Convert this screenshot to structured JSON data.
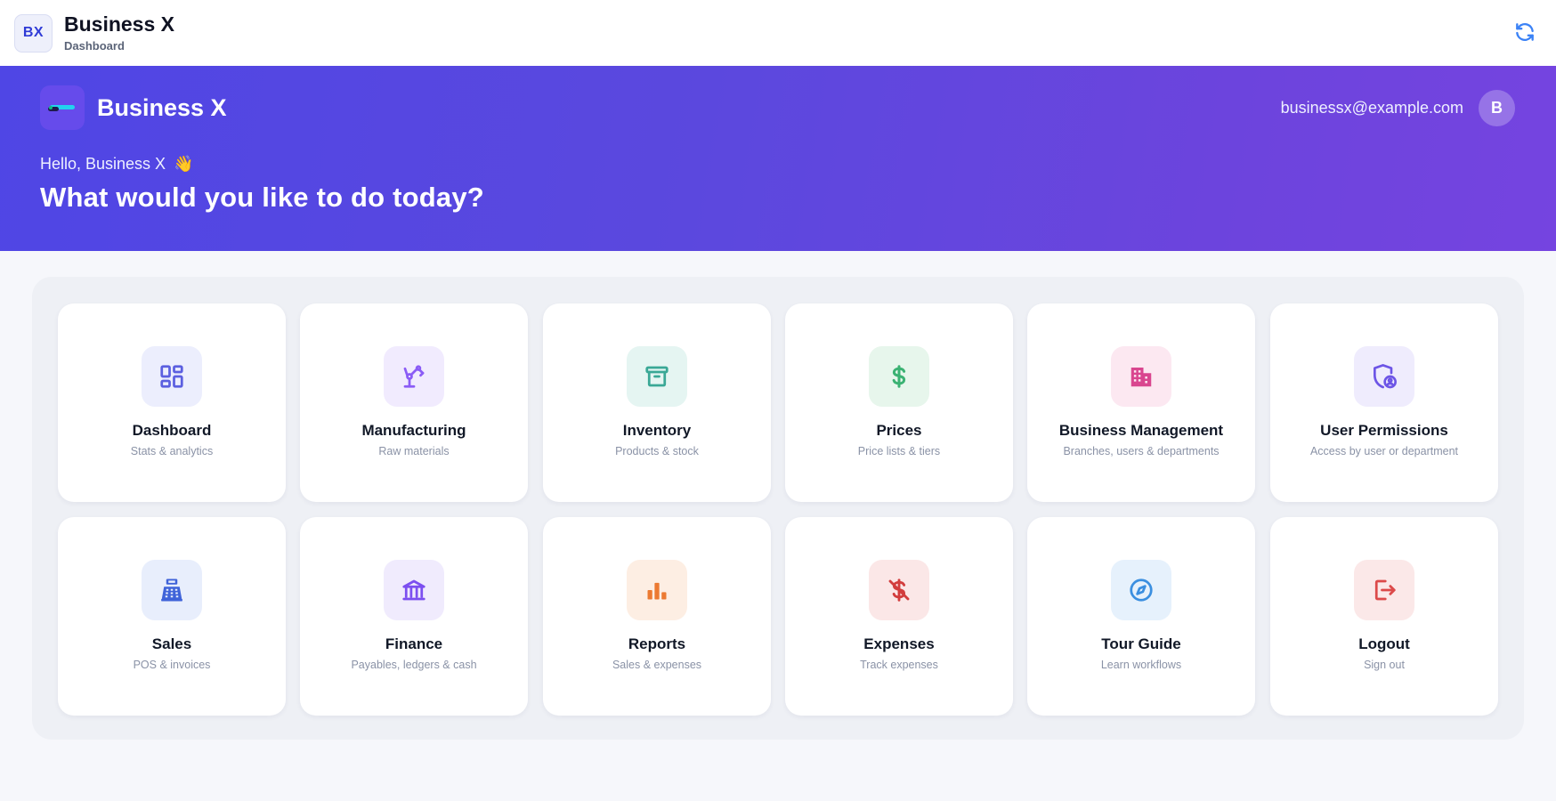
{
  "app": {
    "badge": "BX",
    "title": "Business X",
    "subtitle": "Dashboard",
    "sync_icon": "refresh-icon"
  },
  "hero": {
    "brand_name": "Business X",
    "email": "businessx@example.com",
    "avatar_initial": "B",
    "greeting": "Hello, Business X",
    "wave_emoji": "👋",
    "headline": "What would you like to do today?"
  },
  "tiles": [
    {
      "title": "Dashboard",
      "description": "Stats & analytics",
      "icon": "dashboard-icon",
      "color": "#5b5fe0",
      "bg": "#eceefd"
    },
    {
      "title": "Manufacturing",
      "description": "Raw materials",
      "icon": "robot-arm-icon",
      "color": "#8b5cf6",
      "bg": "#f1ebfe"
    },
    {
      "title": "Inventory",
      "description": "Products & stock",
      "icon": "archive-box-icon",
      "color": "#3aa896",
      "bg": "#e5f5f2"
    },
    {
      "title": "Prices",
      "description": "Price lists & tiers",
      "icon": "dollar-icon",
      "color": "#3bb273",
      "bg": "#e7f6ec"
    },
    {
      "title": "Business Management",
      "description": "Branches, users & departments",
      "icon": "building-icon",
      "color": "#d9468f",
      "bg": "#fce8f1"
    },
    {
      "title": "User Permissions",
      "description": "Access by user or department",
      "icon": "shield-user-icon",
      "color": "#6d55e6",
      "bg": "#efecfd"
    },
    {
      "title": "Sales",
      "description": "POS & invoices",
      "icon": "cash-register-icon",
      "color": "#3f63d9",
      "bg": "#e8eefc"
    },
    {
      "title": "Finance",
      "description": "Payables, ledgers & cash",
      "icon": "bank-icon",
      "color": "#7c4ff0",
      "bg": "#f0ebfd"
    },
    {
      "title": "Reports",
      "description": "Sales & expenses",
      "icon": "bar-chart-icon",
      "color": "#ec7a32",
      "bg": "#fdeee3"
    },
    {
      "title": "Expenses",
      "description": "Track expenses",
      "icon": "dollar-off-icon",
      "color": "#d23d3d",
      "bg": "#fbe7e7"
    },
    {
      "title": "Tour Guide",
      "description": "Learn workflows",
      "icon": "compass-icon",
      "color": "#3b8fe0",
      "bg": "#e6f1fc"
    },
    {
      "title": "Logout",
      "description": "Sign out",
      "icon": "logout-icon",
      "color": "#dc4a4a",
      "bg": "#fbe8e8"
    }
  ]
}
